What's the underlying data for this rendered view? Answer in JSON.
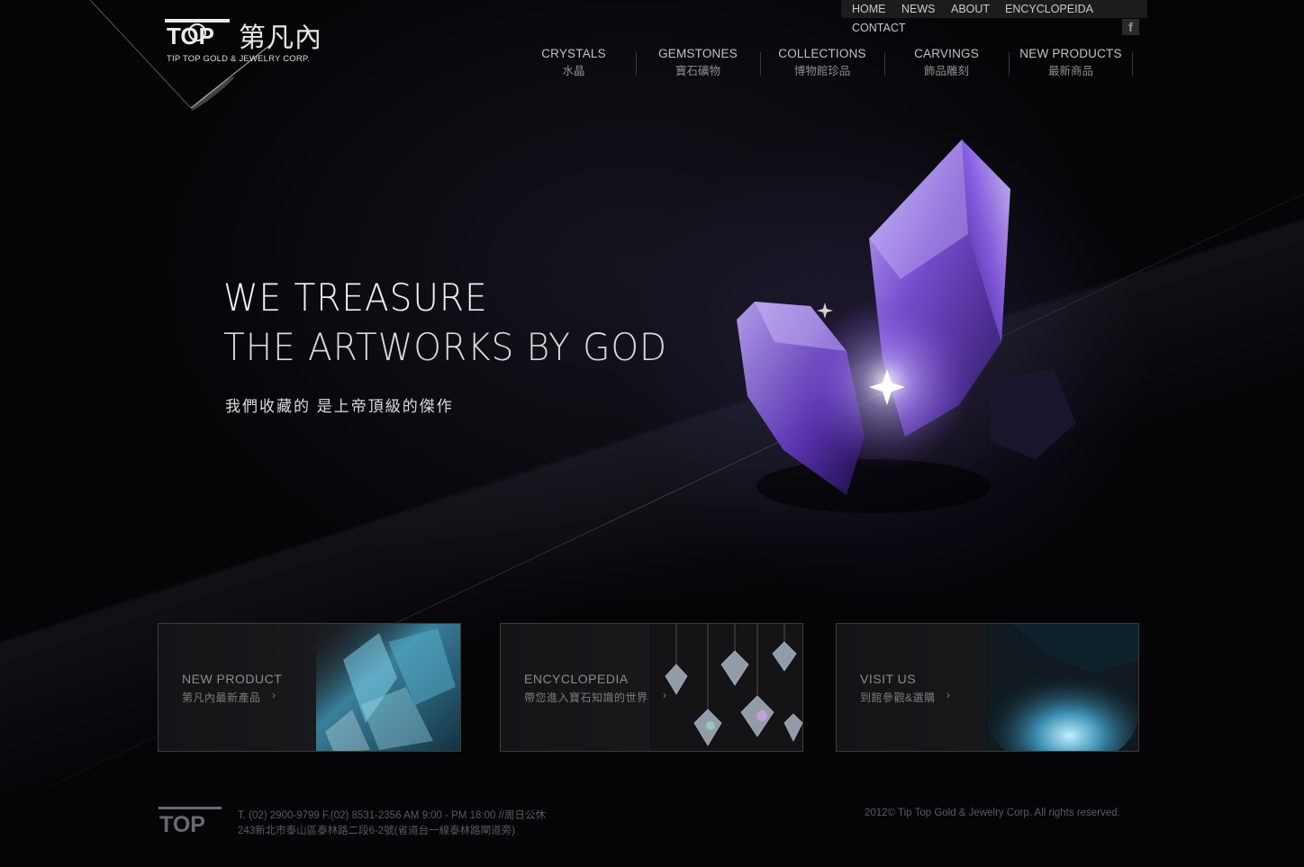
{
  "brand": {
    "logo_text": "TOP",
    "name_cn": "第凡內",
    "name_en": "TIP TOP GOLD & JEWELRY CORP."
  },
  "top_nav": {
    "items": [
      "HOME",
      "NEWS",
      "ABOUT",
      "ENCYCLOPEIDA"
    ],
    "contact": "CONTACT",
    "facebook_icon": "f"
  },
  "main_nav": [
    {
      "en": "CRYSTALS",
      "zh": "水晶"
    },
    {
      "en": "GEMSTONES",
      "zh": "寶石礦物"
    },
    {
      "en": "COLLECTIONS",
      "zh": "博物館珍品"
    },
    {
      "en": "CARVINGS",
      "zh": "飾品雕刻"
    },
    {
      "en": "NEW PRODUCTS",
      "zh": "最新商品"
    }
  ],
  "hero": {
    "line1": "WE TREASURE",
    "line2": "THE ARTWORKS BY GOD",
    "subtitle": "我們收藏的 是上帝頂級的傑作"
  },
  "cards": [
    {
      "title": "NEW PRODUCT",
      "subtitle": "第凡內最新產品",
      "arrow": "›"
    },
    {
      "title": "ENCYCLOPEDIA",
      "subtitle": "帶您進入寶石知識的世界",
      "arrow": "›"
    },
    {
      "title": "VISIT US",
      "subtitle": "到館參觀&選購",
      "arrow": "›"
    }
  ],
  "footer": {
    "line1": "T. (02) 2900-9799 F.(02) 8531-2356 AM 9:00 - PM 18:00 //周日公休",
    "line2": "243新北市泰山區泰林路二段6-2號(省道台一線泰林路閘道旁)",
    "copyright": "2012© Tip Top Gold & Jewelry Corp. All rights reserved."
  },
  "colors": {
    "background": "#050508",
    "crystal_purple": "#7a4fd6",
    "text_light": "#f2f2f2"
  }
}
